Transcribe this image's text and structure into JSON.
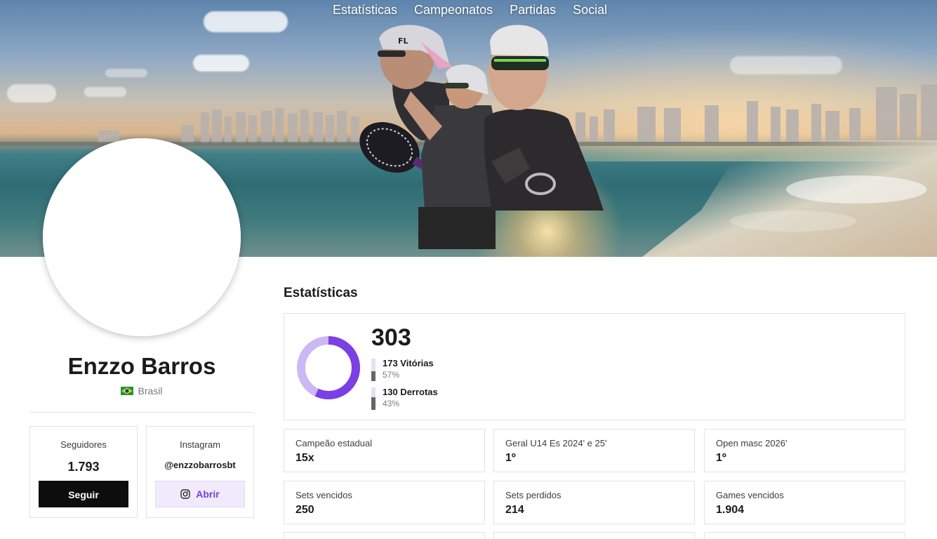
{
  "nav": {
    "items": [
      {
        "label": "Estatísticas"
      },
      {
        "label": "Campeonatos"
      },
      {
        "label": "Partidas"
      },
      {
        "label": "Social"
      }
    ]
  },
  "profile": {
    "name": "Enzzo Barros",
    "country": "Brasil"
  },
  "followers": {
    "label": "Seguidores",
    "value": "1.793",
    "button": "Seguir"
  },
  "instagram": {
    "label": "Instagram",
    "handle": "@enzzobarrosbt",
    "button": "Abrir",
    "icon": "instagram-icon"
  },
  "stats": {
    "title": "Estatísticas",
    "total": "303",
    "wins": {
      "label": "173 Vitórias",
      "percent_label": "57%",
      "fraction": 0.57
    },
    "losses": {
      "label": "130 Derrotas",
      "percent_label": "43%",
      "fraction": 0.43
    },
    "tiles": [
      {
        "label": "Campeão estadual",
        "value": "15x"
      },
      {
        "label": "Geral U14 Es 2024' e 25'",
        "value": "1º"
      },
      {
        "label": "Open masc 2026'",
        "value": "1º"
      },
      {
        "label": "Sets vencidos",
        "value": "250"
      },
      {
        "label": "Sets perdidos",
        "value": "214"
      },
      {
        "label": "Games vencidos",
        "value": "1.904"
      }
    ]
  },
  "colors": {
    "accent": "#7b3fe4",
    "accent_light": "#cbb8f5",
    "button_dark": "#0d0d0d",
    "button_light_bg": "#f1eafc"
  }
}
